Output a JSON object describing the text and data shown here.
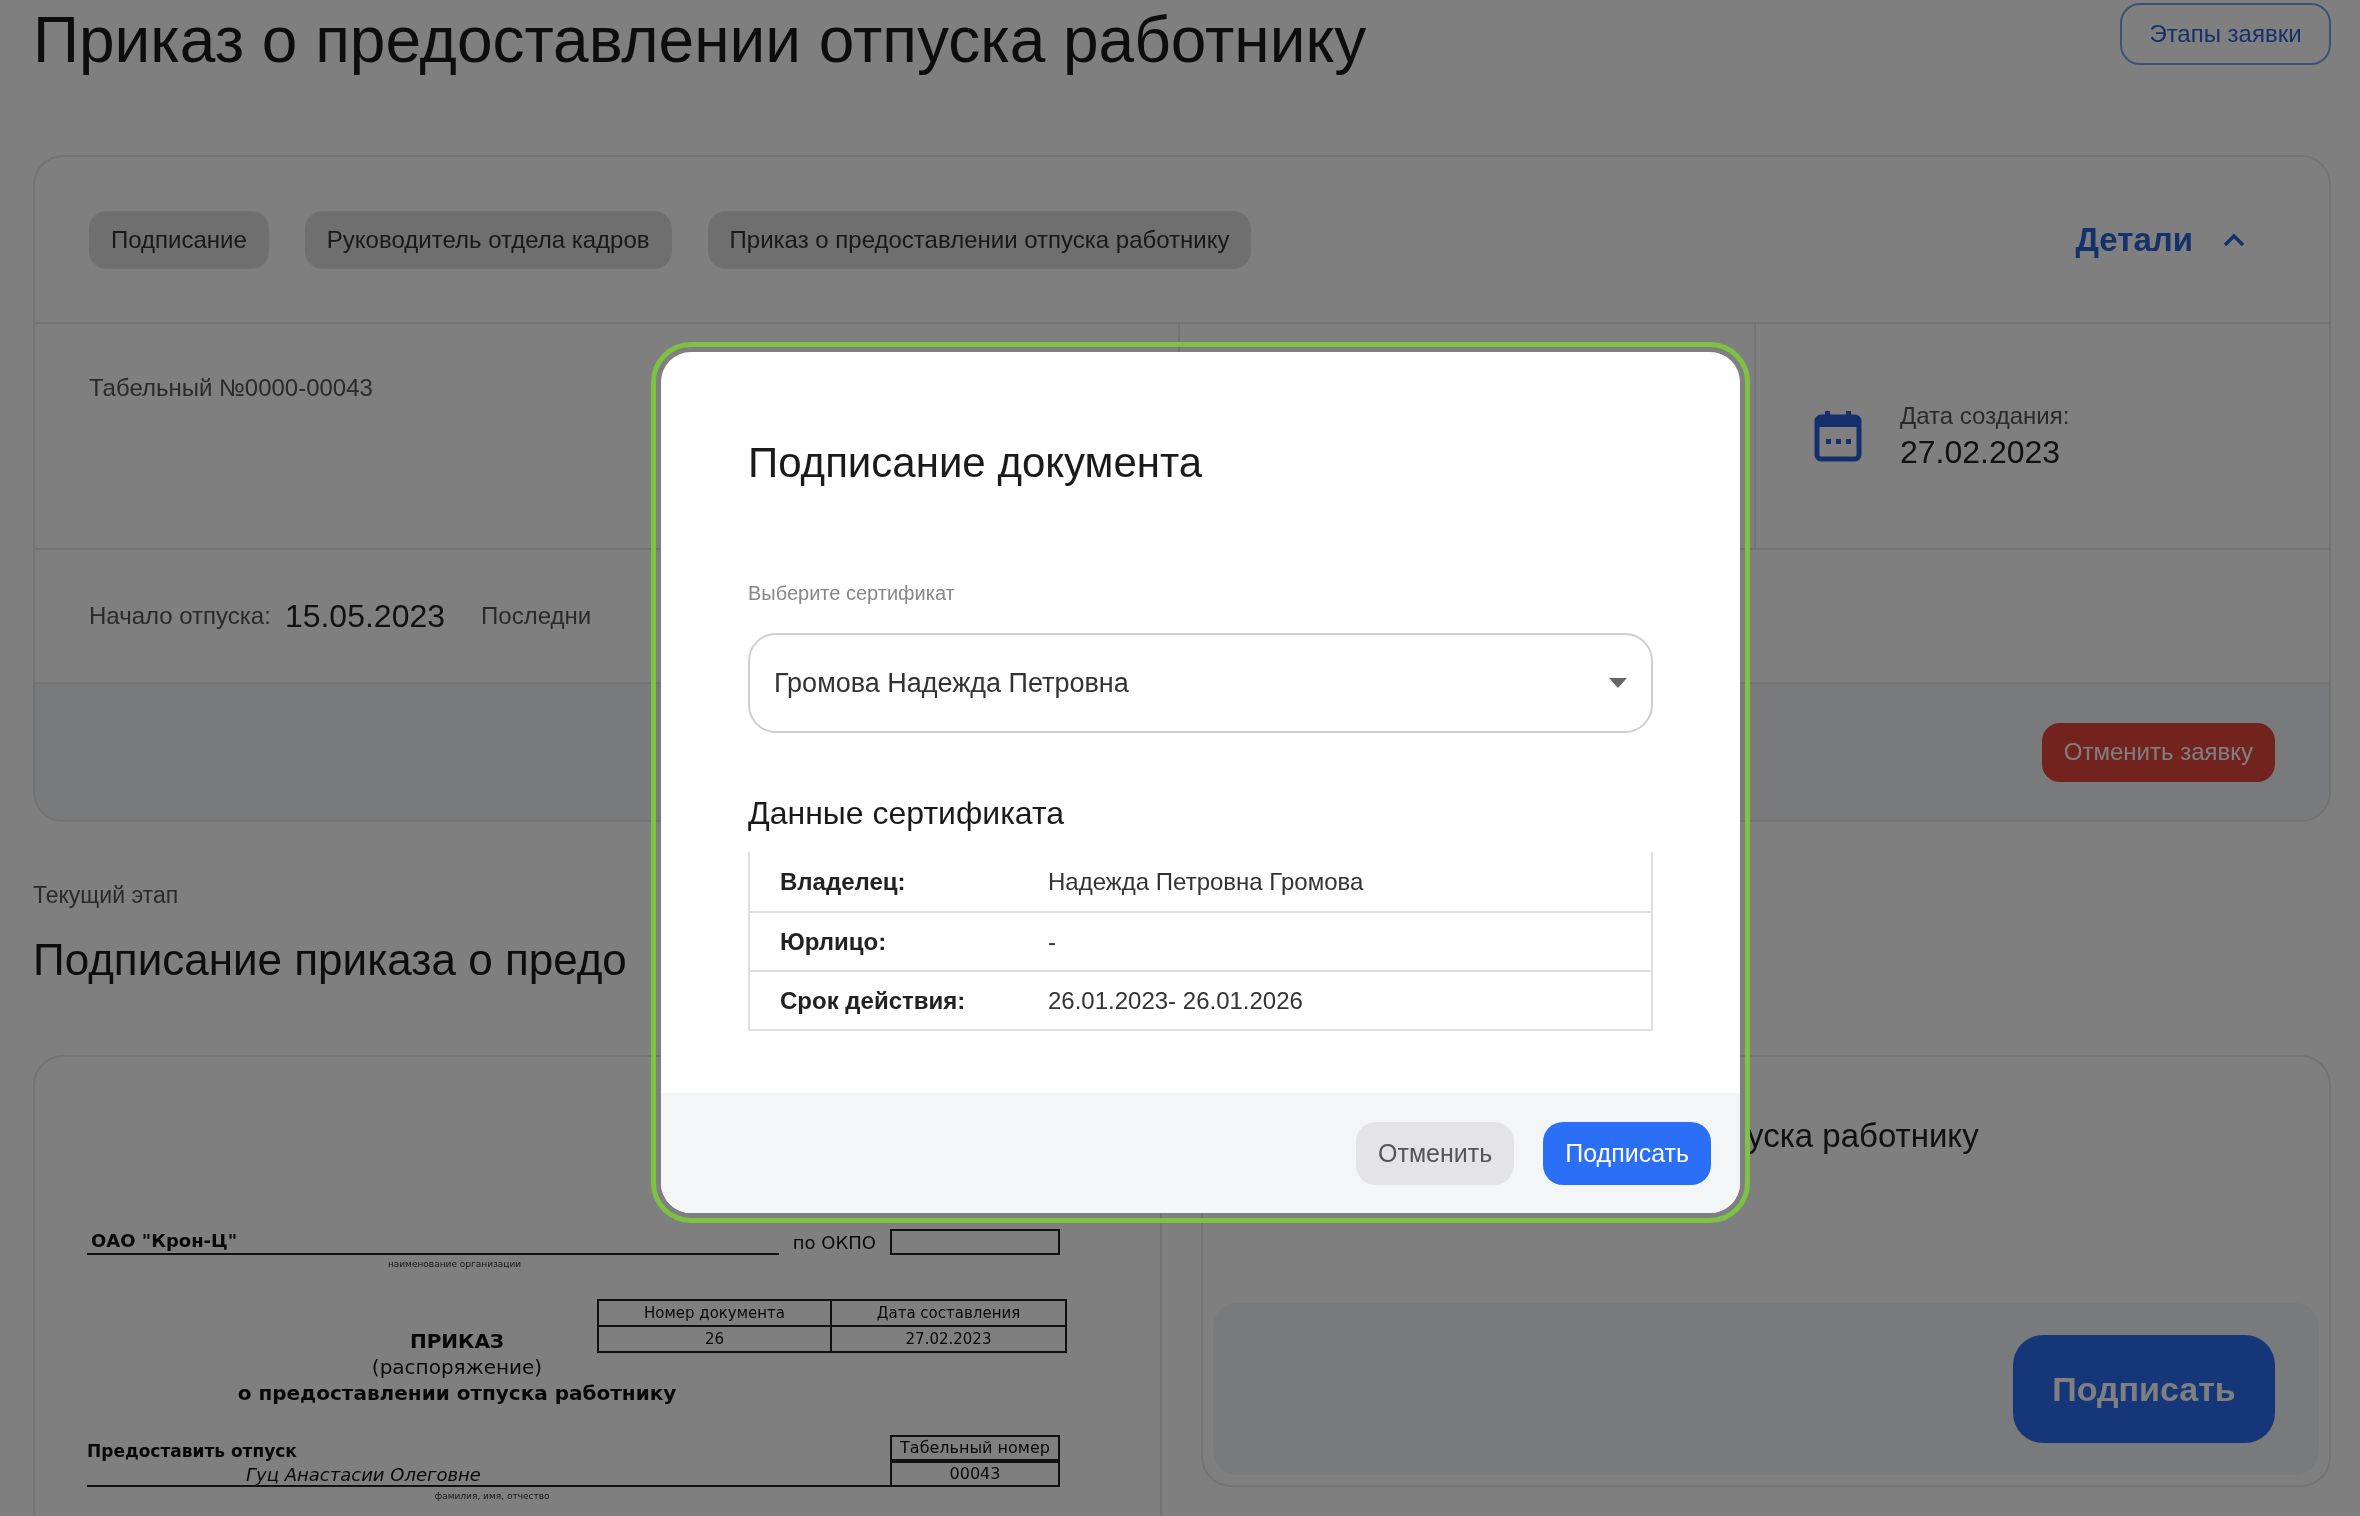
{
  "page": {
    "title": "Приказ о предоставлении отпуска работнику",
    "stages_button": "Этапы заявки"
  },
  "summary_card": {
    "chips": [
      "Подписание",
      "Руководитель отдела кадров",
      "Приказ о предоставлении отпуска работнику"
    ],
    "details_toggle": {
      "label": "Детали",
      "expanded": true
    },
    "employee_number": "Табельный №0000-00043",
    "created": {
      "label": "Дата создания:",
      "value": "27.02.2023"
    },
    "vacation_start": {
      "label": "Начало отпуска:",
      "value": "15.05.2023"
    },
    "last_day_label": "Последни",
    "cancel_button": "Отменить заявку"
  },
  "current_stage": {
    "label": "Текущий этап",
    "title": "Подписание приказа о предо"
  },
  "document_preview": {
    "organization": "ОАО \"Крон-Ц\"",
    "organization_caption": "наименование организации",
    "okpo_label": "по ОКПО",
    "number_header": "Номер документа",
    "date_header": "Дата составления",
    "number": "26",
    "date": "27.02.2023",
    "heading": "ПРИКАЗ",
    "subheading": "(распоряжение)",
    "purpose": "о предоставлении отпуска работнику",
    "grant_label": "Предоставить отпуск",
    "personnel_header": "Табельный номер",
    "employee_name": "Гуц Анастасии Олеговне",
    "personnel_number": "00043",
    "name_caption": "фамилия, имя, отчество"
  },
  "sign_card": {
    "title": "уска работнику",
    "sign_button": "Подписать"
  },
  "dialog": {
    "title": "Подписание документа",
    "certificate_label": "Выберите сертификат",
    "certificate_value": "Громова Надежда Петровна",
    "details_title": "Данные сертификата",
    "details": [
      {
        "label": "Владелец:",
        "value": "Надежда Петровна Громова"
      },
      {
        "label": "Юрлицо:",
        "value": "-"
      },
      {
        "label": "Срок действия:",
        "value": "26.01.2023- 26.01.2026"
      }
    ],
    "buttons": [
      {
        "label": "Отменить",
        "kind": "secondary"
      },
      {
        "label": "Подписать",
        "kind": "primary"
      }
    ]
  }
}
